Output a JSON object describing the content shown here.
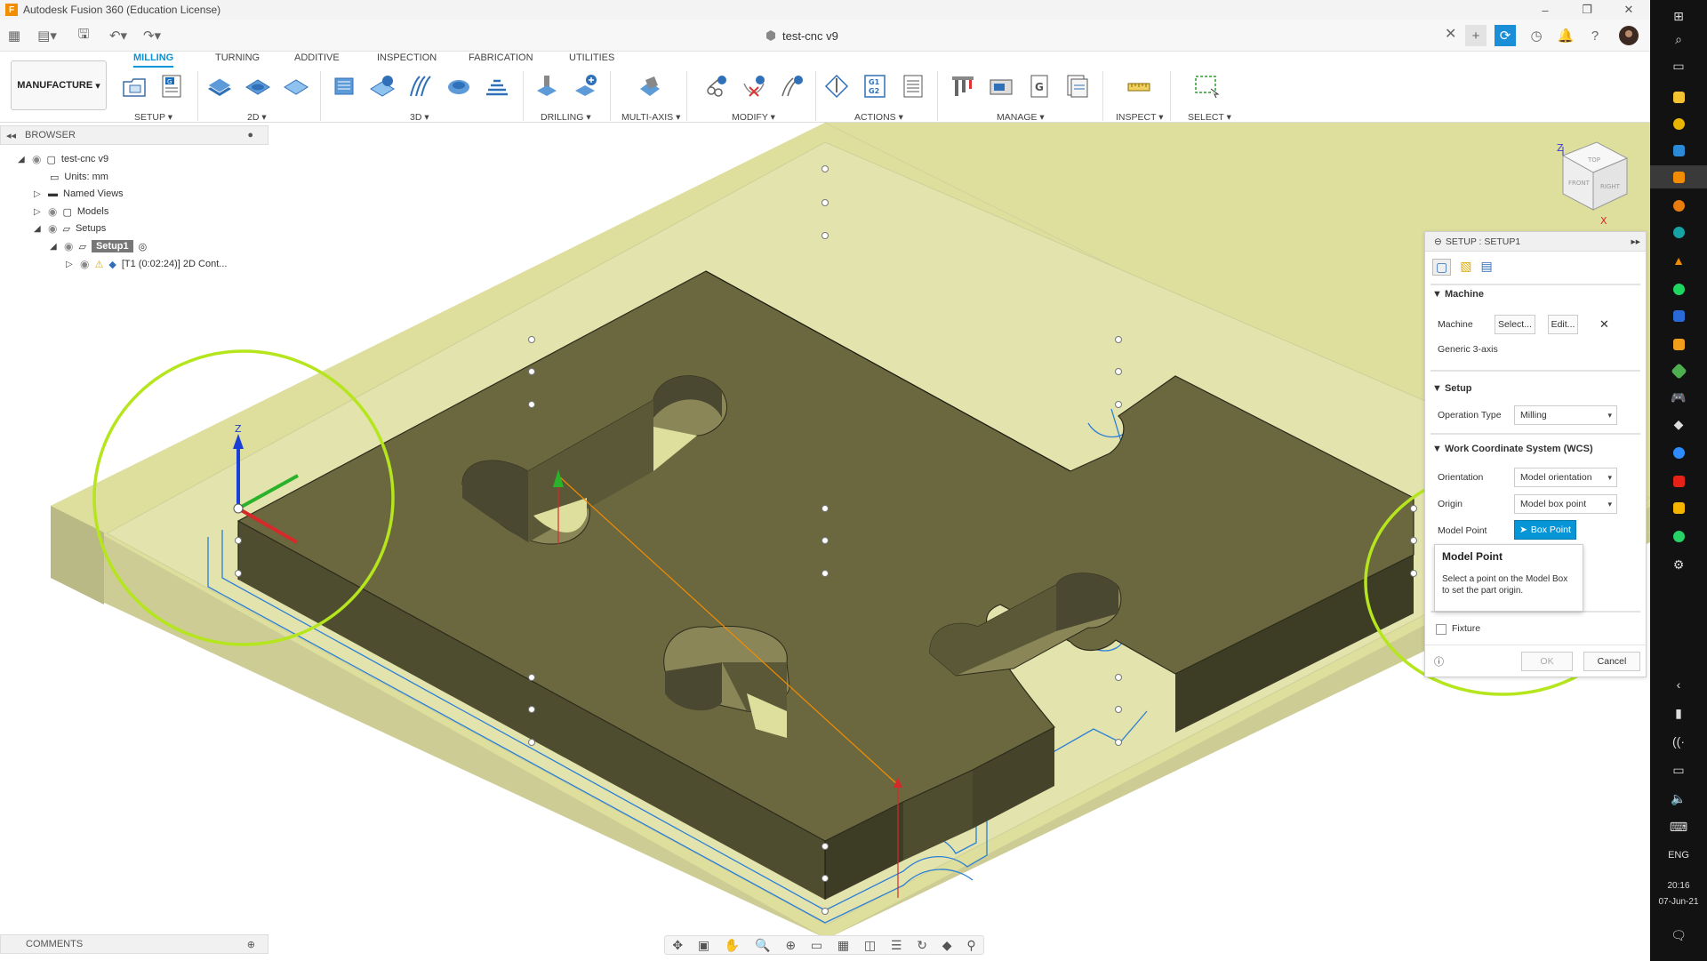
{
  "window": {
    "title": "Autodesk Fusion 360 (Education License)",
    "document": "test-cnc v9"
  },
  "ribbon": {
    "workspace": "MANUFACTURE",
    "tabs": [
      "MILLING",
      "TURNING",
      "ADDITIVE",
      "INSPECTION",
      "FABRICATION",
      "UTILITIES"
    ],
    "groups": [
      "SETUP",
      "2D",
      "3D",
      "DRILLING",
      "MULTI-AXIS",
      "MODIFY",
      "ACTIONS",
      "MANAGE",
      "INSPECT",
      "SELECT"
    ]
  },
  "browser": {
    "header": "BROWSER",
    "root": "test-cnc v9",
    "units": "Units: mm",
    "named_views": "Named Views",
    "models": "Models",
    "setups": "Setups",
    "setup1": "Setup1",
    "operation": "[T1 (0:02:24)] 2D Cont..."
  },
  "comments": "COMMENTS",
  "viewcube": {
    "top": "TOP",
    "front": "FRONT",
    "right": "RIGHT",
    "z": "Z",
    "x": "X"
  },
  "triad": {
    "z": "Z"
  },
  "panel": {
    "title": "SETUP : SETUP1",
    "machine_section": "Machine",
    "machine_label": "Machine",
    "select_button": "Select...",
    "edit_button": "Edit...",
    "machine_value": "Generic 3-axis",
    "setup_section": "Setup",
    "operation_type_label": "Operation Type",
    "operation_type_value": "Milling",
    "wcs_section": "Work Coordinate System (WCS)",
    "orientation_label": "Orientation",
    "orientation_value": "Model orientation",
    "origin_label": "Origin",
    "origin_value": "Model box point",
    "model_point_label": "Model Point",
    "model_point_button": "Box Point",
    "fixture_label": "Fixture",
    "ok_button": "OK",
    "cancel_button": "Cancel"
  },
  "tooltip": {
    "title": "Model Point",
    "text": "Select a point on the Model Box to set the part origin."
  },
  "taskbar": {
    "language": "ENG",
    "time": "20:16",
    "date": "07-Jun-21"
  },
  "colors": {
    "accent": "#0696d7",
    "highlight_circle": "#b5e61d",
    "stock": "#d9d9a3",
    "part_top": "#6b6840",
    "toolpath": "#2a7fd6"
  }
}
